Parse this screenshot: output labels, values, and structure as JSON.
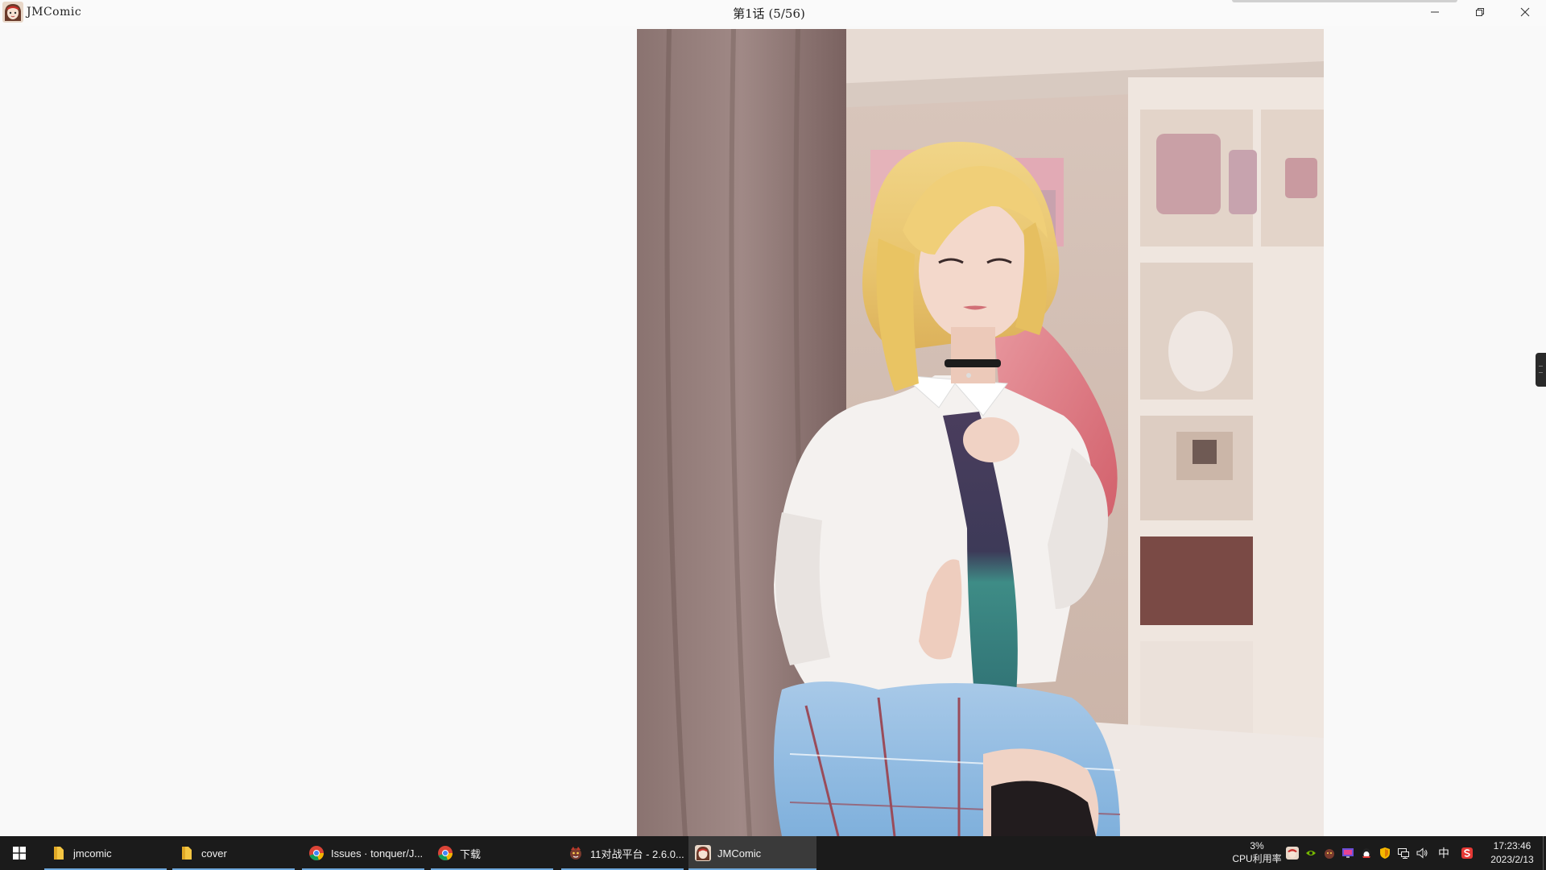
{
  "window": {
    "app_name": "JMComic",
    "title": "第1话 (5/56)"
  },
  "viewer": {
    "image_alt": "comic page 5: cosplay photo of a blonde girl in white shirt, blue tie and plaid skirt"
  },
  "taskbar": {
    "items": [
      {
        "label": "jmcomic",
        "icon": "folder-icon",
        "active": false
      },
      {
        "label": "cover",
        "icon": "folder-icon",
        "active": false
      },
      {
        "label": "Issues · tonquer/J...",
        "icon": "chrome-icon",
        "active": false
      },
      {
        "label": "下载",
        "icon": "chrome-icon",
        "active": false
      },
      {
        "label": "11对战平台 - 2.6.0...",
        "icon": "game-platform-icon",
        "active": false
      },
      {
        "label": "JMComic",
        "icon": "jmcomic-icon",
        "active": true
      }
    ],
    "cpu": {
      "percent": "3%",
      "label": "CPU利用率"
    },
    "ime": "中",
    "clock": {
      "time": "17:23:46",
      "date": "2023/2/13"
    }
  },
  "colors": {
    "taskbar_bg": "#1b1b1b",
    "accent_underline": "#6ea8dc",
    "window_bg": "#f9f9f9"
  }
}
